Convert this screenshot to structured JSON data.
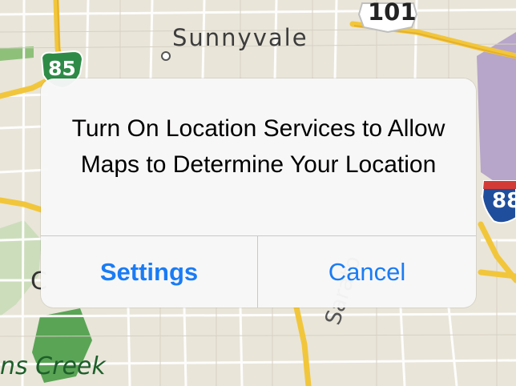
{
  "map": {
    "city_label": "Sunnyvale",
    "creek_label": "ns Creek",
    "street_label": "Sarato",
    "partial_label": "C",
    "shields": {
      "us101": "101",
      "ca85": "85",
      "i88": "88"
    }
  },
  "alert": {
    "message": "Turn On Location Services to Allow Maps to Determine Your Location",
    "settings_label": "Settings",
    "cancel_label": "Cancel"
  },
  "colors": {
    "accent": "#1a7cf5",
    "map_background": "#e9e5d9",
    "highway": "#f2c63b",
    "park": "#5aa455"
  }
}
